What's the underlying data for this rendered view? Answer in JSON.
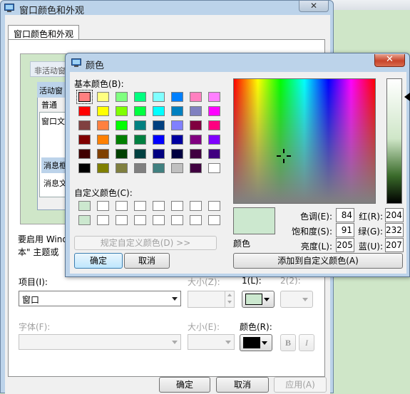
{
  "back_dialog": {
    "title": "窗口颜色和外观",
    "close_glyph": "✕",
    "tab_label": "窗口颜色和外观",
    "preview": {
      "inactive_title": "非活动窗",
      "active_title": "活动窗",
      "normal": "普通",
      "window_text": "窗口文",
      "message_title": "消息框",
      "message_text": "消息文"
    },
    "info_line1": "要启用 Wind",
    "info_line2": "本\" 主题或",
    "item_label": "项目(I):",
    "item_value": "窗口",
    "size1_label": "大小(Z):",
    "color1_label": "1(L):",
    "color2_label": "2(2):",
    "font_label": "字体(F):",
    "size2_label": "大小(E):",
    "font_color_label": "颜色(R):",
    "bold_label": "B",
    "italic_label": "I",
    "ok_label": "确定",
    "cancel_label": "取消",
    "apply_label": "应用(A)",
    "colors": {
      "color1_swatch": "#cce8cf",
      "font_color_swatch": "#000000"
    }
  },
  "color_dialog": {
    "title": "颜色",
    "close_glyph": "✕",
    "basic_colors_label": "基本颜色(B):",
    "basic_colors": [
      [
        "#ff8080",
        "#ffff80",
        "#80ff80",
        "#00ff80",
        "#80ffff",
        "#0080ff",
        "#ff80c0",
        "#ff80ff"
      ],
      [
        "#ff0000",
        "#ffff00",
        "#80ff00",
        "#00ff40",
        "#00ffff",
        "#0080c0",
        "#8080c0",
        "#ff00ff"
      ],
      [
        "#804040",
        "#ff8040",
        "#00ff00",
        "#008080",
        "#004080",
        "#8080ff",
        "#800040",
        "#ff0080"
      ],
      [
        "#800000",
        "#ff8000",
        "#008000",
        "#008040",
        "#0000ff",
        "#0000a0",
        "#800080",
        "#8000ff"
      ],
      [
        "#400000",
        "#804000",
        "#004000",
        "#004040",
        "#000080",
        "#000040",
        "#400040",
        "#400080"
      ],
      [
        "#000000",
        "#808000",
        "#808040",
        "#808080",
        "#408080",
        "#c0c0c0",
        "#400040",
        "#ffffff"
      ]
    ],
    "custom_colors_label": "自定义颜色(C):",
    "custom_colors": [
      [
        "#cce8cf",
        "#ffffff",
        "#ffffff",
        "#ffffff",
        "#ffffff",
        "#ffffff",
        "#ffffff",
        "#ffffff"
      ],
      [
        "#cce8cf",
        "#ffffff",
        "#ffffff",
        "#ffffff",
        "#ffffff",
        "#ffffff",
        "#ffffff",
        "#ffffff"
      ]
    ],
    "define_custom_label": "规定自定义颜色(D) >>",
    "ok_label": "确定",
    "cancel_label": "取消",
    "current_color": "#cce8cf",
    "current_color_label": "颜色",
    "hue_label": "色调(E):",
    "hue": "84",
    "sat_label": "饱和度(S):",
    "sat": "91",
    "lum_label": "亮度(L):",
    "lum": "205",
    "red_label": "红(R):",
    "red": "204",
    "green_label": "绿(G):",
    "green": "232",
    "blue_label": "蓝(U):",
    "blue": "207",
    "add_custom_label": "添加到自定义颜色(A)"
  }
}
